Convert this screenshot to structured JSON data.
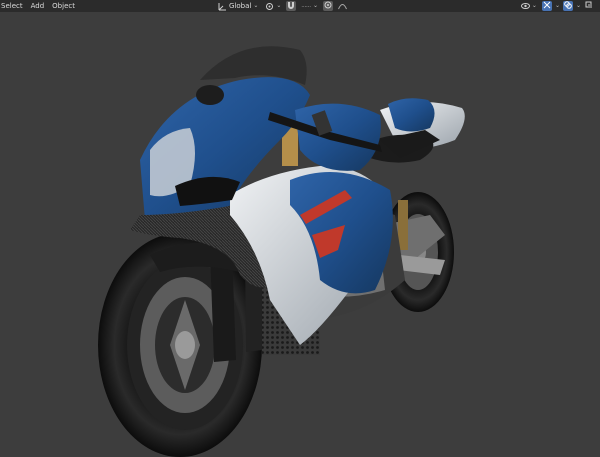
{
  "menu": {
    "items": [
      {
        "label": "Select"
      },
      {
        "label": "Add"
      },
      {
        "label": "Object"
      }
    ]
  },
  "header_tools": {
    "transform_orientation": "Global",
    "snap_target_label": "......"
  },
  "colors": {
    "header_bg": "#2b2b2b",
    "viewport_bg": "#3d3d3d",
    "accent": "#4772b3",
    "bike_blue": "#1f4f8c",
    "bike_white": "#d9dde0",
    "bike_red": "#c0392b"
  },
  "scene": {
    "object": "motorcycle-model"
  }
}
